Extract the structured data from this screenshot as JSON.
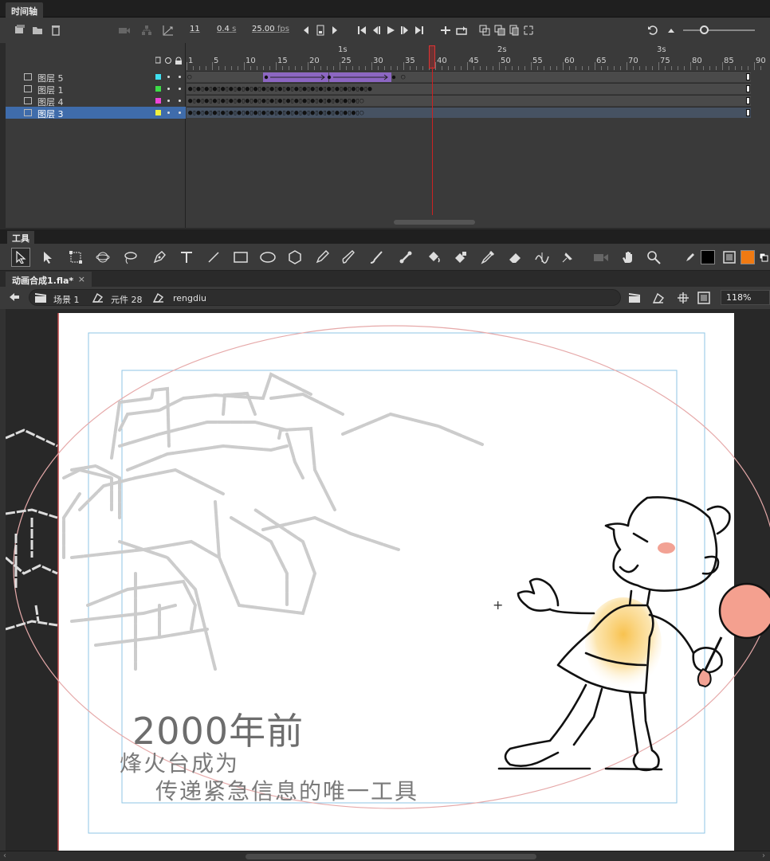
{
  "timeline": {
    "panel_title": "时间轴",
    "current_frame": "11",
    "elapsed_time": "0.4",
    "elapsed_unit": "s",
    "fps_value": "25.00",
    "fps_unit": "fps",
    "seconds_labels": [
      "1s",
      "2s",
      "3s"
    ],
    "frame_numbers": [
      "1",
      "5",
      "10",
      "15",
      "20",
      "25",
      "30",
      "35",
      "40",
      "45",
      "50",
      "55",
      "60",
      "65",
      "70",
      "75",
      "80",
      "85",
      "90"
    ],
    "layers": [
      {
        "name": "图层 5",
        "color": "#3fe0f0",
        "selected": false
      },
      {
        "name": "图层 1",
        "color": "#3ddc47",
        "selected": false
      },
      {
        "name": "图层 4",
        "color": "#ee44d8",
        "selected": false
      },
      {
        "name": "图层 3",
        "color": "#f0f040",
        "selected": true
      }
    ]
  },
  "tools": {
    "panel_title": "工具",
    "stroke_color": "#000000",
    "fill_color": "#f07a12"
  },
  "document": {
    "tab_title": "动画合成1.fla*",
    "tab_close": "×",
    "breadcrumb": [
      {
        "label": "场景 1",
        "icon": "clapper-icon"
      },
      {
        "label": "元件 28",
        "icon": "movieclip-symbol-icon"
      },
      {
        "label": "rengdiu",
        "icon": "movieclip-symbol-icon"
      }
    ],
    "zoom": "118%"
  },
  "stage": {
    "caption_year": "2000年前",
    "caption_line1": "烽火台成为",
    "caption_line2": "传递紧急信息的唯一工具",
    "registration_mark": "+"
  }
}
